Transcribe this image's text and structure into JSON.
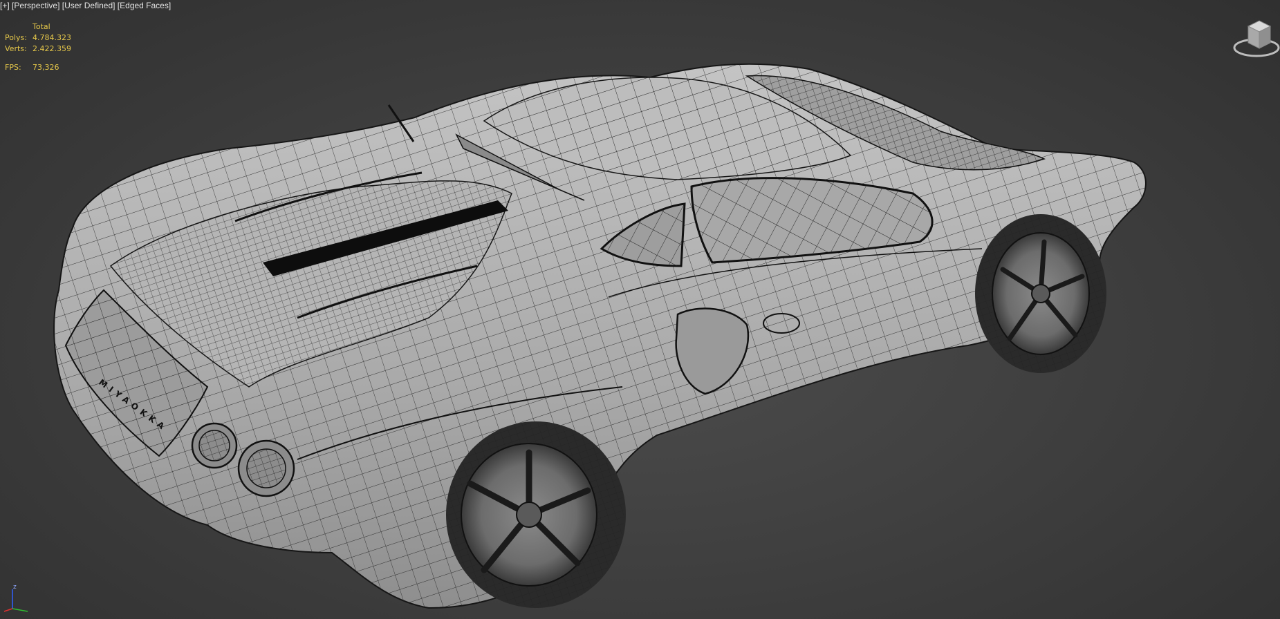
{
  "viewport": {
    "label_parts": [
      "+",
      "Perspective",
      "User Defined",
      "Edged Faces"
    ]
  },
  "stats": {
    "header": "Total",
    "polys_label": "Polys:",
    "polys_value": "4.784.323",
    "verts_label": "Verts:",
    "verts_value": "2.422.359",
    "fps_label": "FPS:",
    "fps_value": "73,326"
  },
  "model": {
    "badge_text": "MIYAOKKA"
  },
  "axis": {
    "z": "z"
  },
  "colors": {
    "stats_text": "#e6c84a",
    "label_text": "#e4e4e4",
    "wire": "#1a1a1a",
    "body_light": "#b8b8b8",
    "axis_x": "#e03030",
    "axis_y": "#30c030",
    "axis_z": "#3060ff"
  }
}
